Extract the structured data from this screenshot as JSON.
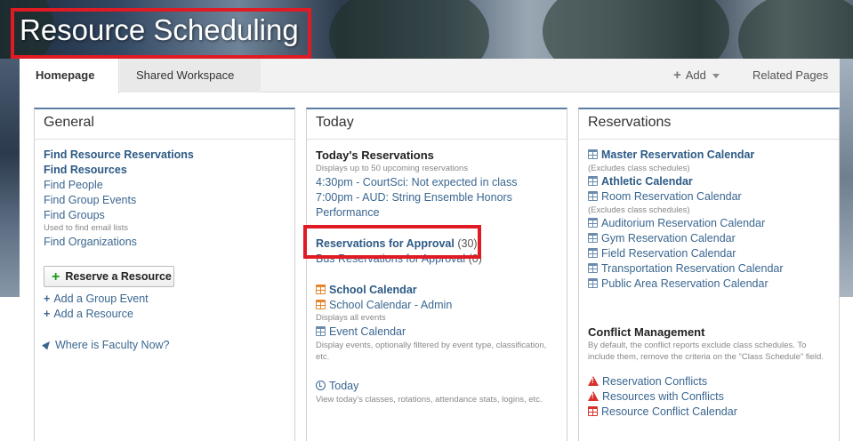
{
  "app": {
    "title": "Resource Scheduling"
  },
  "tabs": [
    {
      "label": "Homepage"
    },
    {
      "label": "Shared Workspace"
    }
  ],
  "toolbar": {
    "add_label": "Add",
    "related_label": "Related Pages"
  },
  "general": {
    "title": "General",
    "links": [
      {
        "label": "Find Resource Reservations"
      },
      {
        "label": "Find Resources"
      },
      {
        "label": "Find People"
      },
      {
        "label": "Find Group Events"
      },
      {
        "label": "Find Groups"
      },
      {
        "label": "Find Organizations"
      }
    ],
    "groups_note": "Used to find email lists",
    "reserve_button": "Reserve a Resource",
    "add_group_event": "Add a Group Event",
    "add_resource": "Add a Resource",
    "where_faculty": "Where is Faculty Now?"
  },
  "today": {
    "title": "Today",
    "reservations_heading": "Today's Reservations",
    "reservations_note": "Displays up to 50 upcoming reservations",
    "events": [
      {
        "label": "4:30pm - CourtSci: Not expected in class"
      },
      {
        "label": "7:00pm - AUD: String Ensemble Honors"
      },
      {
        "label": "Performance"
      }
    ],
    "approval_label": "Reservations for Approval",
    "approval_count": "(30)",
    "bus_label": "Bus Reservations for Approval",
    "bus_count": "(0)",
    "school_calendar": "School Calendar",
    "school_calendar_admin": "School Calendar - Admin",
    "displays_all": "Displays all events",
    "event_calendar": "Event Calendar",
    "event_calendar_note": "Display events, optionally filtered by event type, classification, etc.",
    "today_link": "Today",
    "today_note": "View today's classes, rotations, attendance stats, logins, etc."
  },
  "reservations": {
    "title": "Reservations",
    "calendars": [
      {
        "label": "Master Reservation Calendar"
      },
      {
        "label": "Athletic Calendar"
      },
      {
        "label": "Room Reservation Calendar"
      },
      {
        "label": "Auditorium Reservation Calendar"
      },
      {
        "label": "Gym Reservation Calendar"
      },
      {
        "label": "Field Reservation Calendar"
      },
      {
        "label": "Transportation Reservation Calendar"
      },
      {
        "label": "Public Area Reservation Calendar"
      }
    ],
    "excludes_note": "(Excludes class schedules)",
    "conflict_heading": "Conflict Management",
    "conflict_note": "By default, the conflict reports exclude class schedules. To include them, remove the criteria on the \"Class Schedule\" field.",
    "reservation_conflicts": "Reservation Conflicts",
    "resources_with_conflicts": "Resources with Conflicts",
    "resource_conflict_calendar": "Resource Conflict Calendar"
  },
  "colors": {
    "link": "#3a6690",
    "highlight_box": "#e01b24",
    "panel_accent": "#5a7ea3"
  }
}
